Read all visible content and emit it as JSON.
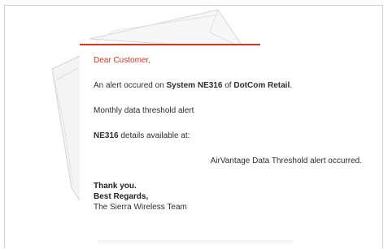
{
  "colors": {
    "accent": "#e1321f",
    "text": "#2d2d2d",
    "border": "#cfcfcf"
  },
  "email": {
    "greeting": "Dear Customer,",
    "alert_line": {
      "prefix": "An alert occured on ",
      "system": "System NE316",
      "middle": " of ",
      "company": "DotCom Retail",
      "suffix": "."
    },
    "alert_type": "Monthly data threshold alert",
    "details_line": {
      "system_id": "NE316",
      "suffix": " details available at:"
    },
    "link_text": "AirVantage Data Threshold alert occurred.",
    "closing": {
      "thanks": "Thank you.",
      "regards": "Best Regards,",
      "signature": "The Sierra Wireless Team"
    }
  }
}
